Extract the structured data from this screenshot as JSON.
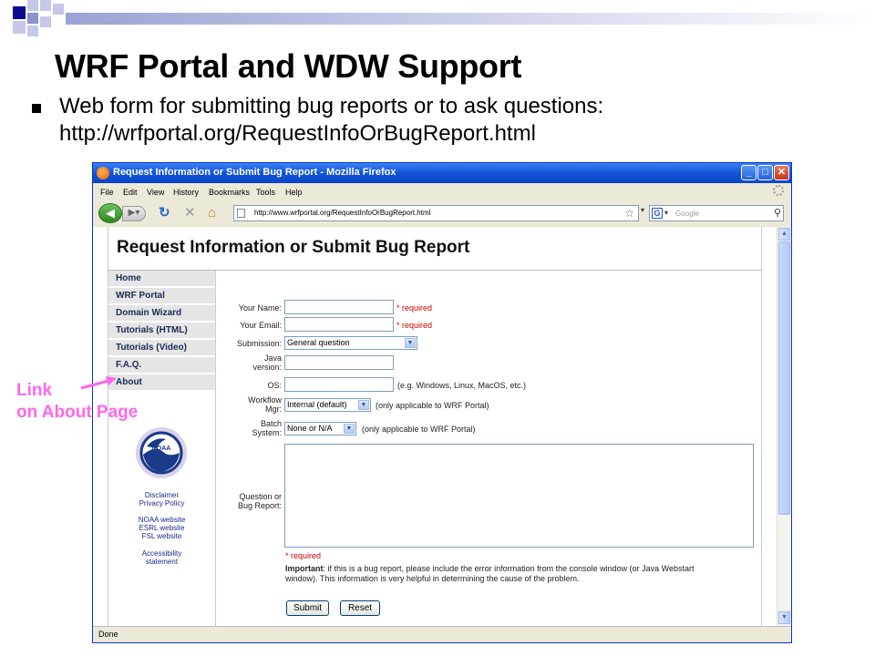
{
  "slide": {
    "title": "WRF Portal and WDW Support",
    "bullet_line1": "Web form for submitting bug reports or to ask questions:",
    "bullet_line2": "http://wrfportal.org/RequestInfoOrBugReport.html"
  },
  "window": {
    "title": "Request Information or Submit Bug Report - Mozilla Firefox",
    "minimize": "_",
    "maximize": "□",
    "close": "✕"
  },
  "menu": [
    "File",
    "Edit",
    "View",
    "History",
    "Bookmarks",
    "Tools",
    "Help"
  ],
  "nav": {
    "url": "http://www.wrfportal.org/RequestInfoOrBugReport.html",
    "search_placeholder": "Google",
    "search_engine_letter": "G"
  },
  "page": {
    "heading": "Request Information or Submit Bug Report",
    "sidebar": [
      "Home",
      "WRF Portal",
      "Domain Wizard",
      "Tutorials (HTML)",
      "Tutorials (Video)",
      "F.A.Q.",
      "About"
    ],
    "logo_text": "NOAA",
    "links": {
      "disclaimer": "Disclaimer",
      "privacy": "Privacy Policy",
      "noaa": "NOAA website",
      "esrl": "ESRL website",
      "fsl": "FSL website",
      "accessibility1": "Accessibility",
      "accessibility2": "statement"
    }
  },
  "form": {
    "name_label": "Your Name:",
    "email_label": "Your Email:",
    "required": "* required",
    "submission_label": "Submission:",
    "submission_value": "General question",
    "java_label1": "Java",
    "java_label2": "version:",
    "os_label": "OS:",
    "os_hint": "(e.g. Windows, Linux, MacOS, etc.)",
    "workflow_label1": "Workflow",
    "workflow_label2": "Mgr:",
    "workflow_value": "Internal (default)",
    "applicable_note": "(only applicable to WRF Portal)",
    "batch_label1": "Batch",
    "batch_label2": "System:",
    "batch_value": "None or N/A",
    "question_label1": "Question or",
    "question_label2": "Bug Report:",
    "important_bold": "Important",
    "important_line1": ": if this is a bug report, please include the error information from the console window (or Java Webstart",
    "important_line2": "window). This information is very helpful in determining the cause of the problem.",
    "submit": "Submit",
    "reset": "Reset"
  },
  "status": "Done",
  "annotation": {
    "line1": "Link",
    "line2": "on About Page"
  },
  "colors": {
    "annotation": "#ff66ee",
    "titlebar": "#1253d8",
    "required": "#cc0000"
  }
}
